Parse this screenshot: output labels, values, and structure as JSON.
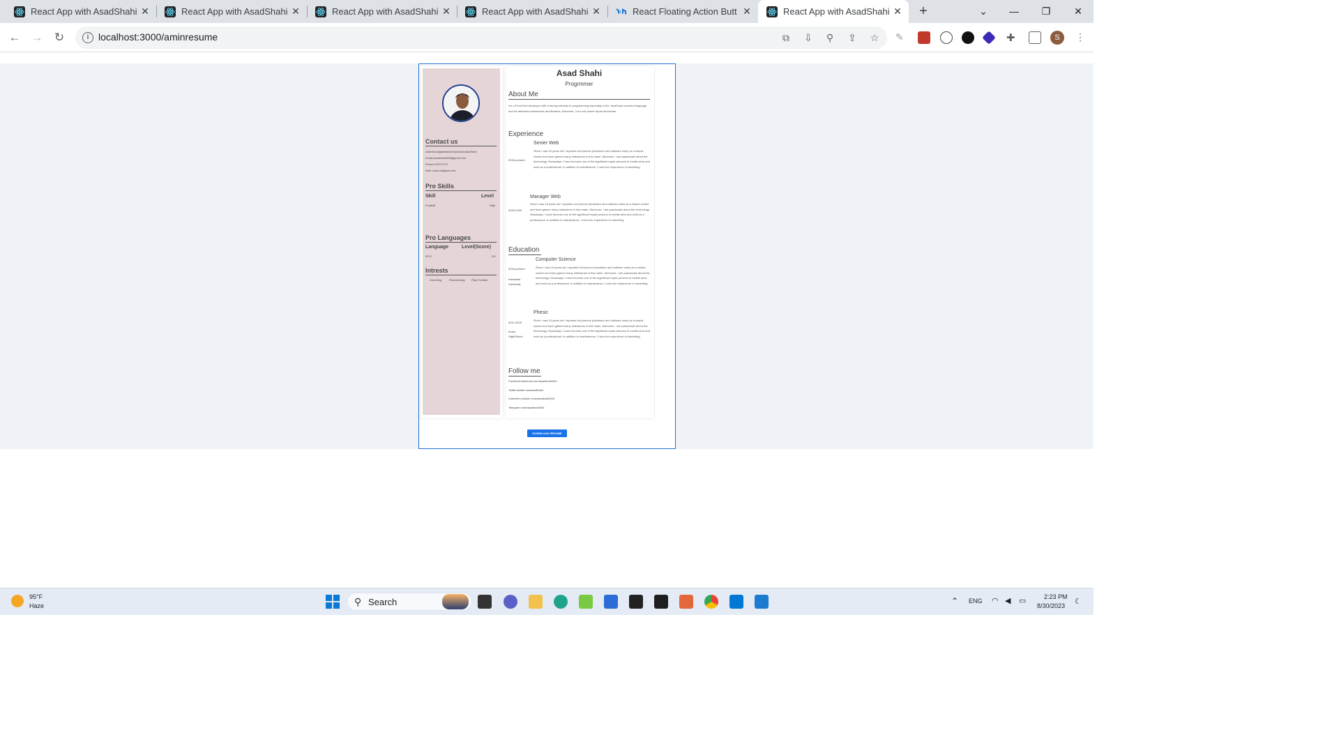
{
  "browser": {
    "tabs": [
      {
        "title": "React App with AsadShahi",
        "active": false
      },
      {
        "title": "React App with AsadShahi",
        "active": false
      },
      {
        "title": "React App with AsadShahi",
        "active": false
      },
      {
        "title": "React App with AsadShahi",
        "active": false
      },
      {
        "title": "React Floating Action Button",
        "active": false
      },
      {
        "title": "React App with AsadShahi",
        "active": true
      }
    ],
    "url": "localhost:3000/aminresume",
    "profile_initial": "S"
  },
  "resume": {
    "name": "Asad Shahi",
    "role": "Progrmmer",
    "about_heading": "About Me",
    "about_text": "I'm a Front-End developer with a strong interests in programming especially in the JavaScript powerful language and it's attractive frameworks and libraries. Moreover, I'm a cell phone repair technician.",
    "contact_heading": "Contact us",
    "contact": [
      "Address:Afghanistan,Kandhar,KabulShah",
      "Email:asadshahi504@gmail.com",
      "Phone:078727707",
      "Web: www.mailgam.com"
    ],
    "skills_heading": "Pro Skills",
    "skills_col_skill": "Skill",
    "skills_col_level": "Level",
    "skills": [
      {
        "skill": "Football",
        "level": "High"
      }
    ],
    "languages_heading": "Pro Languages",
    "languages_col_language": "Language",
    "languages_col_level": "Level(Score)",
    "languages": [
      {
        "language": "IELS",
        "score": "5.5"
      }
    ],
    "interests_heading": "Intrests",
    "interests": [
      "Gamming",
      "Researching",
      "Play Football"
    ],
    "experience_heading": "Experience",
    "experience": [
      {
        "period": "2015-present",
        "title": "Senier Web",
        "text": "Since I was 15 years old I repaired cell phones (hardware and software wise) as a simple worker and have gained many milestones in this realm. Moreover, I am passionate about the technology. Nowadays, I have become one of the significant repair persons in mobile area and work as a professional. In addition to maintenance, I have the experience of marketing."
      },
      {
        "period": "2015-2020",
        "title": "Manager Web",
        "text": "Since I was 15 years old I repaired cell phones (hardware and software wise) as a simple worker and have gained many milestones in this realm. Moreover, I am passionate about the technology. Nowadays, I have become one of the significant repair persons in mobile area and work as a professional. In addition to maintenance, I have the experience of marketing."
      }
    ],
    "education_heading": "Education",
    "education": [
      {
        "period": "2015-present",
        "place": "Kandahar University",
        "title": "Computer Science",
        "text": "Since I was 15 years old I repaired cell phones (hardware and software wise) as a simple worker and have gained many milestones in this realm. Moreover, I am passionate about the technology. Nowadays, I have become one of the significant repair persons in mobile area and work as a professional. In addition to maintenance, I have the experience of marketing."
      },
      {
        "period": "2011-2016",
        "place": "Imam HighSchool",
        "title": "Phesic",
        "text": "Since I was 15 years old I repaired cell phones (hardware and software wise) as a simple worker and have gained many milestones in this realm. Moreover, I am passionate about the technology. Nowadays, I have become one of the significant repair persons in mobile area and work as a professional. In addition to maintenance, I have the experience of marketing."
      }
    ],
    "follow_heading": "Follow me",
    "follow": [
      "Facebook:facebook.com/asadshahi404",
      "Twitter:twitter.me/asadShahi",
      "LinkedIn:LinkedIn.com/asadshahi404",
      "Telegram:t.me/asadshahi300"
    ],
    "download_label": "DOWNLOAD RESUME"
  },
  "taskbar": {
    "weather_temp": "95°F",
    "weather_cond": "Haze",
    "search_placeholder": "Search",
    "lang": "ENG",
    "time": "2:23 PM",
    "date": "8/30/2023"
  },
  "colors": {
    "frame_border": "#1e6fd9",
    "sidebar_bg": "#e5d5d7",
    "button_bg": "#1a73e8"
  }
}
